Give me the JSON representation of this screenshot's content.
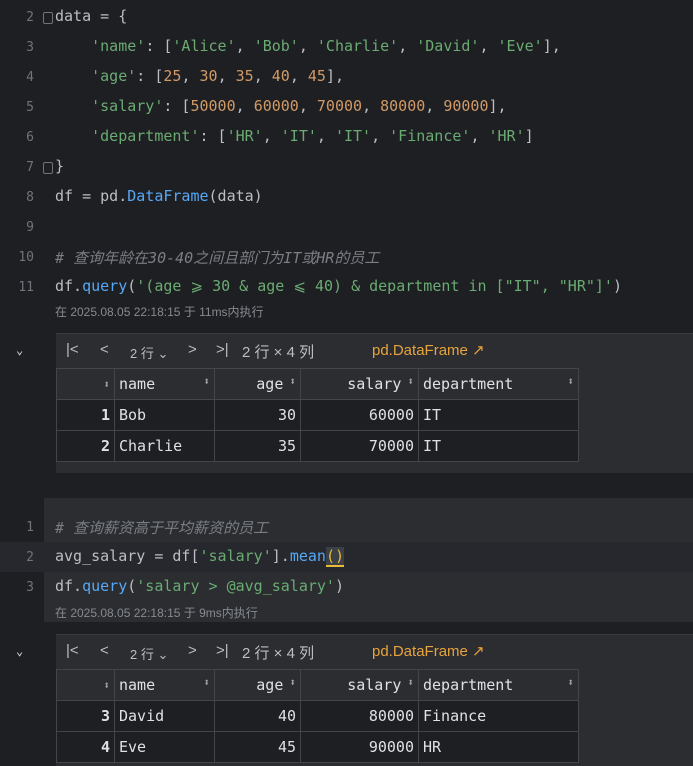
{
  "cell1": {
    "lines": [
      {
        "no": "2",
        "code": "data = {"
      },
      {
        "no": "3",
        "code": "    'name': ['Alice', 'Bob', 'Charlie', 'David', 'Eve'],"
      },
      {
        "no": "4",
        "code": "    'age': [25, 30, 35, 40, 45],"
      },
      {
        "no": "5",
        "code": "    'salary': [50000, 60000, 70000, 80000, 90000],"
      },
      {
        "no": "6",
        "code": "    'department': ['HR', 'IT', 'IT', 'Finance', 'HR']"
      },
      {
        "no": "7",
        "code": "}"
      },
      {
        "no": "8",
        "code": "df = pd.DataFrame(data)"
      },
      {
        "no": "9",
        "code": ""
      },
      {
        "no": "10",
        "code": "# 查询年龄在30-40之间且部门为IT或HR的员工"
      },
      {
        "no": "11",
        "code": "df.query('(age ⩾ 30 & age ⩽ 40) & department in [\"IT\", \"HR\"]')"
      }
    ],
    "exec_info": "在 2025.08.05 22:18:15 于 11ms内执行"
  },
  "output1": {
    "rows_select": "2 行",
    "summary": "2 行 × 4 列",
    "df_link": "pd.DataFrame ↗",
    "headers": [
      "name",
      "age",
      "salary",
      "department"
    ],
    "rows": [
      {
        "idx": "1",
        "name": "Bob",
        "age": "30",
        "salary": "60000",
        "department": "IT"
      },
      {
        "idx": "2",
        "name": "Charlie",
        "age": "35",
        "salary": "70000",
        "department": "IT"
      }
    ]
  },
  "cell2": {
    "lines": [
      {
        "no": "1",
        "code": "# 查询薪资高于平均薪资的员工"
      },
      {
        "no": "2",
        "code": "avg_salary = df['salary'].mean()"
      },
      {
        "no": "3",
        "code": "df.query('salary > @avg_salary')"
      }
    ],
    "exec_info": "在 2025.08.05 22:18:15 于 9ms内执行"
  },
  "output2": {
    "rows_select": "2 行",
    "summary": "2 行 × 4 列",
    "df_link": "pd.DataFrame ↗",
    "headers": [
      "name",
      "age",
      "salary",
      "department"
    ],
    "rows": [
      {
        "idx": "3",
        "name": "David",
        "age": "40",
        "salary": "80000",
        "department": "Finance"
      },
      {
        "idx": "4",
        "name": "Eve",
        "age": "45",
        "salary": "90000",
        "department": "HR"
      }
    ]
  },
  "icons": {
    "first": "first-page-icon",
    "prev": "prev-page-icon",
    "next": "next-page-icon",
    "last": "last-page-icon",
    "collapse": "chevron-down-icon",
    "sort": "sort-icon"
  }
}
